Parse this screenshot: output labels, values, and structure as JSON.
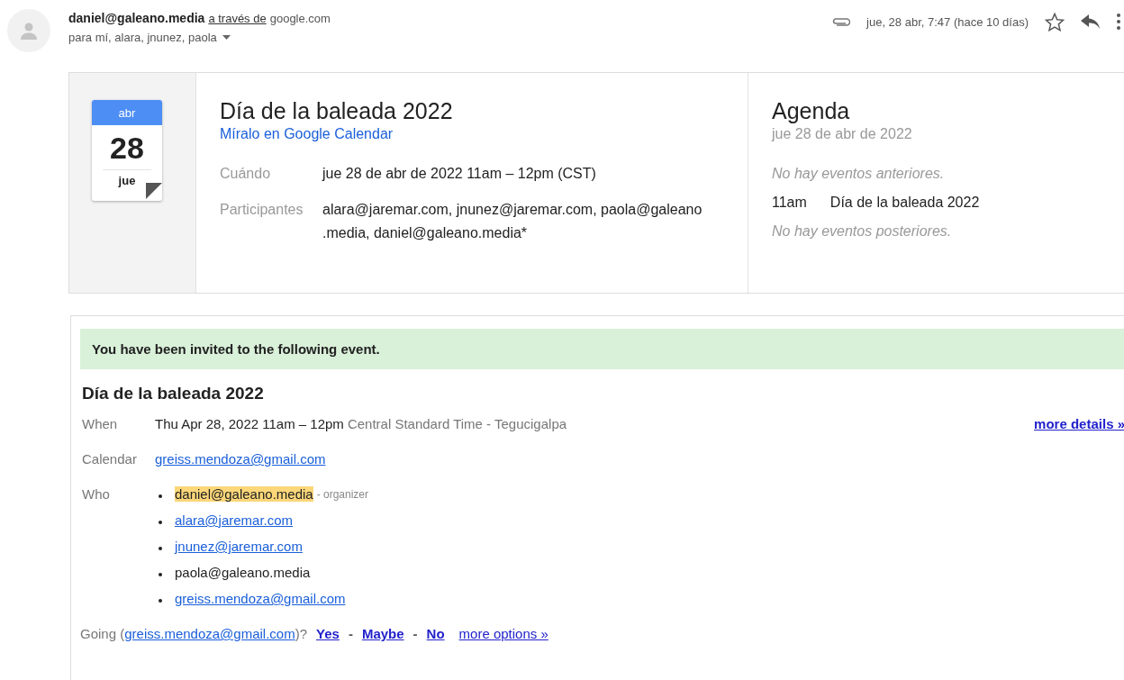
{
  "header": {
    "sender": "daniel@galeano.media",
    "via_label": "a través de",
    "via_domain": "google.com",
    "recipients": "para mí, alara, jnunez, paola",
    "date": "jue, 28 abr, 7:47 (hace 10 días)",
    "has_attachment": true,
    "starred": false
  },
  "summary_card": {
    "calendar_icon": {
      "month": "abr",
      "day": "28",
      "weekday": "jue"
    },
    "title": "Día de la baleada 2022",
    "calendar_link": "Míralo en Google Calendar",
    "fields": [
      {
        "label": "Cuándo",
        "value": "jue 28 de abr de 2022 11am – 12pm (CST)"
      },
      {
        "label": "Participantes",
        "value": "alara@jaremar.com, jnunez@jaremar.com, paola@galeano .media, daniel@galeano.media*"
      }
    ],
    "agenda": {
      "title": "Agenda",
      "date": "jue 28 de abr de 2022",
      "before": "No hay eventos anteriores.",
      "event_time": "11am",
      "event_title": "Día de la baleada 2022",
      "after": "No hay eventos posteriores."
    }
  },
  "invite": {
    "banner": "You have been invited to the following event.",
    "title": "Día de la baleada 2022",
    "when_label": "When",
    "when_value": "Thu Apr 28, 2022 11am – 12pm",
    "when_zone": "Central Standard Time - Tegucigalpa",
    "more_details": "more details »",
    "calendar_label": "Calendar",
    "calendar_value": "greiss.mendoza@gmail.com",
    "who_label": "Who",
    "guests": [
      {
        "kind": "organizer",
        "email": "daniel@galeano.media",
        "role": "- organizer"
      },
      {
        "kind": "link",
        "email": "alara@jaremar.com"
      },
      {
        "kind": "link",
        "email": "jnunez@jaremar.com"
      },
      {
        "kind": "text",
        "email": "paola@galeano.media"
      },
      {
        "kind": "link",
        "email": "greiss.mendoza@gmail.com"
      }
    ],
    "going": {
      "label_start": "Going (",
      "account": "greiss.mendoza@gmail.com",
      "label_end": ")?",
      "options": [
        "Yes",
        "Maybe",
        "No"
      ],
      "separator": "-",
      "more_options": "more options »"
    }
  }
}
